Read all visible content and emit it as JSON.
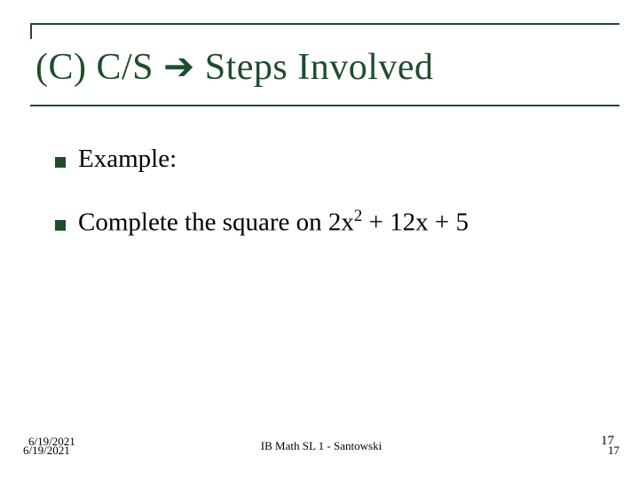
{
  "title": "(C) C/S → Steps Involved",
  "title_parts": {
    "prefix": "(C) C/S ",
    "arrow": "→",
    "suffix": " Steps Involved"
  },
  "bullets": [
    {
      "text": "Example:"
    },
    {
      "text_pre": "Complete the square on 2x",
      "sup": "2",
      "text_post": " + 12x + 5"
    }
  ],
  "footer": {
    "date_a": "6/19/2021",
    "date_b": "6/19/2021",
    "center": "IB Math SL 1 - Santowski",
    "page_a": "17",
    "page_b": "17"
  }
}
